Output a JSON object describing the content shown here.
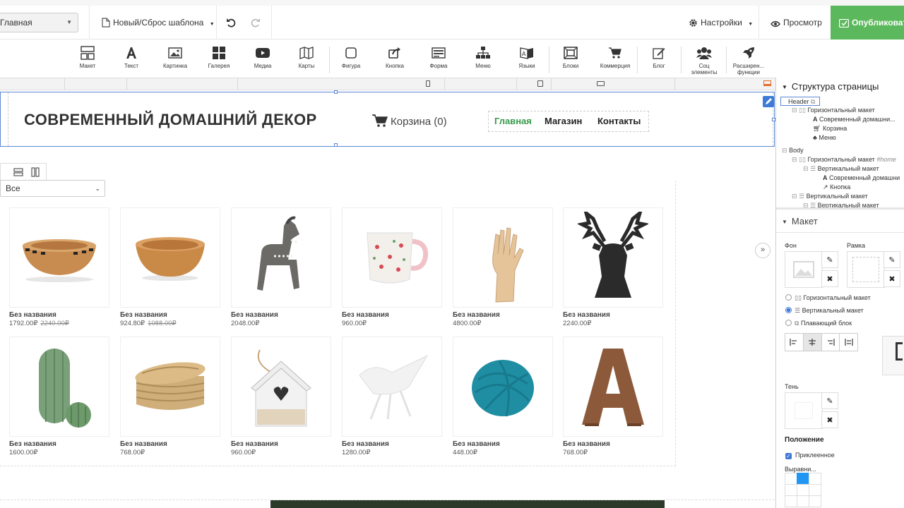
{
  "topbar": {
    "page_selector": "Главная",
    "new_reset_template": "Новый/Сброс шаблона",
    "settings": "Настройки",
    "preview": "Просмотр",
    "publish": "Опубликовать"
  },
  "tools": [
    {
      "label": "Макет",
      "icon": "layout-icon"
    },
    {
      "label": "Текст",
      "icon": "text-icon"
    },
    {
      "label": "Картинка",
      "icon": "image-icon"
    },
    {
      "label": "Галерея",
      "icon": "gallery-icon"
    },
    {
      "label": "Медиа",
      "icon": "media-icon"
    },
    {
      "label": "Карты",
      "icon": "map-icon"
    },
    {
      "label": "Фигура",
      "icon": "shape-icon"
    },
    {
      "label": "Кнопка",
      "icon": "button-icon"
    },
    {
      "label": "Форма",
      "icon": "form-icon"
    },
    {
      "label": "Меню",
      "icon": "menu-icon"
    },
    {
      "label": "Языки",
      "icon": "languages-icon"
    },
    {
      "label": "Блоки",
      "icon": "blocks-icon"
    },
    {
      "label": "Коммерция",
      "icon": "cart-icon"
    },
    {
      "label": "Блог",
      "icon": "blog-icon"
    },
    {
      "label": "Соц элементы",
      "icon": "social-icon"
    },
    {
      "label": "Расширен... функции",
      "icon": "rocket-icon"
    }
  ],
  "header": {
    "site_title": "СОВРЕМЕННЫЙ ДОМАШНИЙ ДЕКОР",
    "cart": "Корзина (0)",
    "nav": [
      "Главная",
      "Магазин",
      "Контакты"
    ]
  },
  "catalog": {
    "filter_value": "Все",
    "products": [
      {
        "name": "Без названия",
        "price": "1792.00₽",
        "old_price": "2240.00₽",
        "picture": "striped-bowl"
      },
      {
        "name": "Без названия",
        "price": "924.80₽",
        "old_price": "1088.00₽",
        "picture": "wooden-bowl"
      },
      {
        "name": "Без названия",
        "price": "2048.00₽",
        "old_price": "",
        "picture": "wooden-horse"
      },
      {
        "name": "Без названия",
        "price": "960.00₽",
        "old_price": "",
        "picture": "floral-mug"
      },
      {
        "name": "Без названия",
        "price": "4800.00₽",
        "old_price": "",
        "picture": "wooden-hand"
      },
      {
        "name": "Без названия",
        "price": "2240.00₽",
        "old_price": "",
        "picture": "deer-head"
      },
      {
        "name": "Без названия",
        "price": "1600.00₽",
        "old_price": "",
        "picture": "cactus-figures"
      },
      {
        "name": "Без названия",
        "price": "768.00₽",
        "old_price": "",
        "picture": "wicker-basket"
      },
      {
        "name": "Без названия",
        "price": "960.00₽",
        "old_price": "",
        "picture": "birdhouse"
      },
      {
        "name": "Без названия",
        "price": "1280.00₽",
        "old_price": "",
        "picture": "white-bird"
      },
      {
        "name": "Без названия",
        "price": "448.00₽",
        "old_price": "",
        "picture": "yarn-ball"
      },
      {
        "name": "Без названия",
        "price": "768.00₽",
        "old_price": "",
        "picture": "wooden-letter-a"
      }
    ]
  },
  "structure": {
    "title": "Структура страницы",
    "rows": [
      {
        "text": "Header",
        "icon": "layers-icon"
      },
      {
        "text": "Горизонтальный макет",
        "icon": "horizontal-layout-icon"
      },
      {
        "text": "Современный домашни...",
        "icon": "text-icon"
      },
      {
        "text": "Корзина",
        "icon": "cart-icon"
      },
      {
        "text": "Меню",
        "icon": "menu-icon"
      },
      {
        "text": "Body",
        "icon": ""
      },
      {
        "text": "Горизонтальный макет",
        "suffix": "#home",
        "icon": "horizontal-layout-icon"
      },
      {
        "text": "Вертикальный макет",
        "icon": "vertical-layout-icon"
      },
      {
        "text": "Современный домашни",
        "icon": "text-icon"
      },
      {
        "text": "Кнопка",
        "icon": "button-icon"
      },
      {
        "text": "Вертикальный макет",
        "icon": "vertical-layout-icon"
      },
      {
        "text": "Вертикальный макет",
        "icon": "vertical-layout-icon"
      }
    ]
  },
  "layout_panel": {
    "title": "Макет",
    "background": "Фон",
    "border": "Рамка",
    "options": [
      "Горизонтальный макет",
      "Вертикальный макет",
      "Плавающий блок"
    ],
    "selected_option": "Вертикальный макет",
    "shadow": "Тень",
    "position": "Положение",
    "sticky": "Приклеенное",
    "alignment": "Выравни..."
  },
  "colors": {
    "accent": "#3f7ad6",
    "publish": "#5cb85c",
    "nav_active": "#3a9a4e",
    "grid_selected": "#2196f3"
  }
}
